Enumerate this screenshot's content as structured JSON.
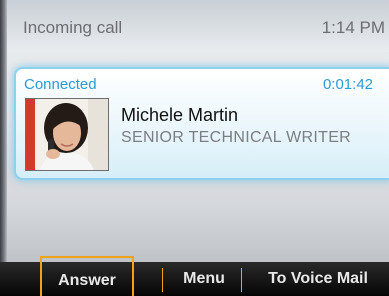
{
  "status_bar": {
    "title": "Incoming call",
    "time": "1:14 PM"
  },
  "call": {
    "status": "Connected",
    "duration": "0:01:42",
    "caller_name": "Michele Martin",
    "caller_title": "SENIOR TECHNICAL WRITER",
    "avatar_icon": "contact-photo"
  },
  "softkeys": {
    "answer": "Answer",
    "menu": "Menu",
    "voicemail": "To Voice Mail"
  },
  "colors": {
    "accent": "#2c9ad6",
    "card_glow": "#8fd0ef",
    "softkey_highlight": "#f2a11a"
  }
}
